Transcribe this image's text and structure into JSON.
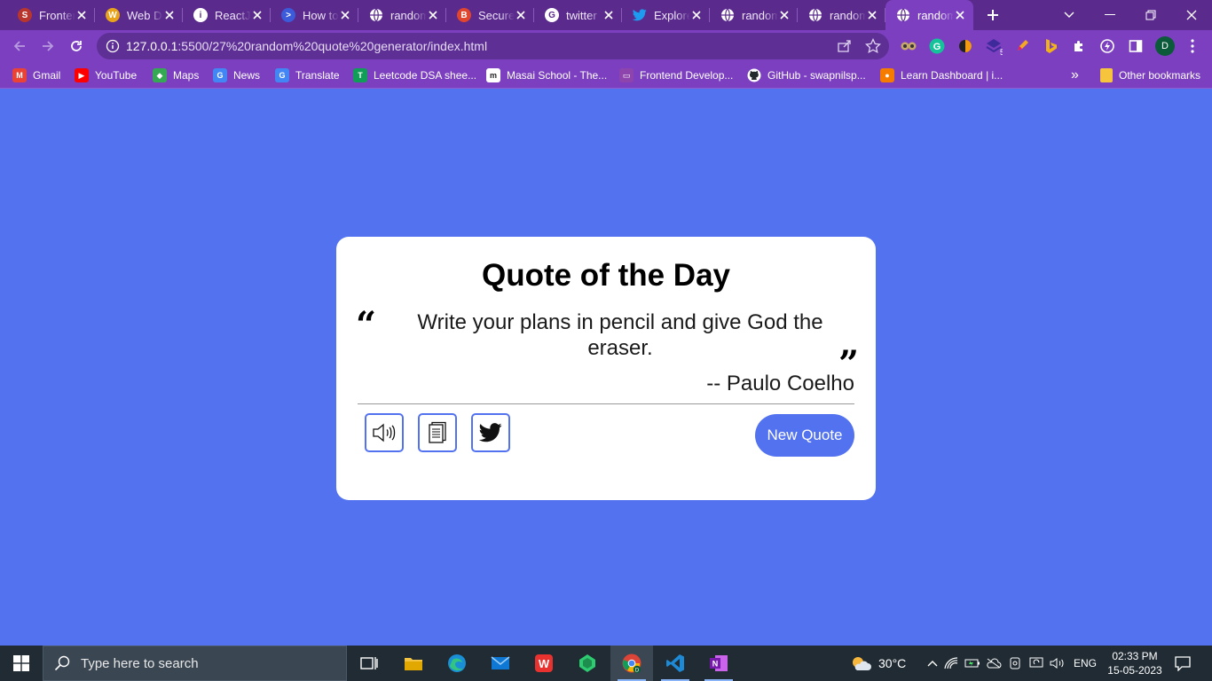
{
  "browser": {
    "tabs": [
      {
        "title": "Frontend",
        "favicon": "frontend-favicon",
        "color": "#b9362c",
        "glyph": "S"
      },
      {
        "title": "Web Dev",
        "favicon": "web-dev-favicon",
        "color": "#e8a31a",
        "glyph": "W"
      },
      {
        "title": "ReactJS",
        "favicon": "info-favicon",
        "color": "#ffffff",
        "glyph": "i"
      },
      {
        "title": "How to",
        "favicon": "terminal-favicon",
        "color": "#3b5bdb",
        "glyph": ">"
      },
      {
        "title": "random",
        "favicon": "globe-favicon",
        "color": "#ffffff",
        "glyph": ""
      },
      {
        "title": "Secure",
        "favicon": "brave-favicon",
        "color": "#e0452d",
        "glyph": "B"
      },
      {
        "title": "twitter",
        "favicon": "google-favicon",
        "color": "#ffffff",
        "glyph": "G"
      },
      {
        "title": "Explore",
        "favicon": "twitter-favicon",
        "color": "#1d9bf0",
        "glyph": ""
      },
      {
        "title": "random",
        "favicon": "globe-favicon",
        "color": "#ffffff",
        "glyph": ""
      },
      {
        "title": "random",
        "favicon": "globe-favicon",
        "color": "#ffffff",
        "glyph": ""
      },
      {
        "title": "random",
        "favicon": "globe-favicon",
        "color": "#ffffff",
        "glyph": ""
      }
    ],
    "active_tab_index": 10,
    "url_host": "127.0.0.1",
    "url_rest": ":5500/27%20random%20quote%20generator/index.html",
    "extension_badge": "5",
    "profile_initial": "D",
    "bookmarks": [
      {
        "label": "Gmail",
        "icon": "gmail-icon",
        "color": "#ea4335",
        "glyph": "M"
      },
      {
        "label": "YouTube",
        "icon": "youtube-icon",
        "color": "#ff0000",
        "glyph": "▶"
      },
      {
        "label": "Maps",
        "icon": "maps-icon",
        "color": "#34a853",
        "glyph": "◆"
      },
      {
        "label": "News",
        "icon": "news-icon",
        "color": "#4285f4",
        "glyph": "G"
      },
      {
        "label": "Translate",
        "icon": "translate-icon",
        "color": "#4285f4",
        "glyph": "G"
      },
      {
        "label": "Leetcode DSA shee...",
        "icon": "sheets-icon",
        "color": "#0f9d58",
        "glyph": "T"
      },
      {
        "label": "Masai School - The...",
        "icon": "masai-icon",
        "color": "#ffffff",
        "glyph": "m"
      },
      {
        "label": "Frontend Develop...",
        "icon": "frontend-monitor-icon",
        "color": "#8e44ad",
        "glyph": "▭"
      },
      {
        "label": "GitHub - swapnilsp...",
        "icon": "github-icon",
        "color": "#ffffff",
        "glyph": ""
      },
      {
        "label": "Learn Dashboard | i...",
        "icon": "learn-icon",
        "color": "#f57c00",
        "glyph": "●"
      }
    ],
    "more_bookmarks": "»",
    "other_bookmarks": "Other bookmarks"
  },
  "app": {
    "title": "Quote of the Day",
    "open_quote": "“",
    "close_quote": "”",
    "quote": "Write your plans in pencil and give God the eraser.",
    "author": "-- Paulo Coelho",
    "new_quote_label": "New Quote",
    "accent": "#5372f0"
  },
  "taskbar": {
    "search_placeholder": "Type here to search",
    "weather": "30°C",
    "language": "ENG",
    "time": "02:33 PM",
    "date": "15-05-2023"
  }
}
